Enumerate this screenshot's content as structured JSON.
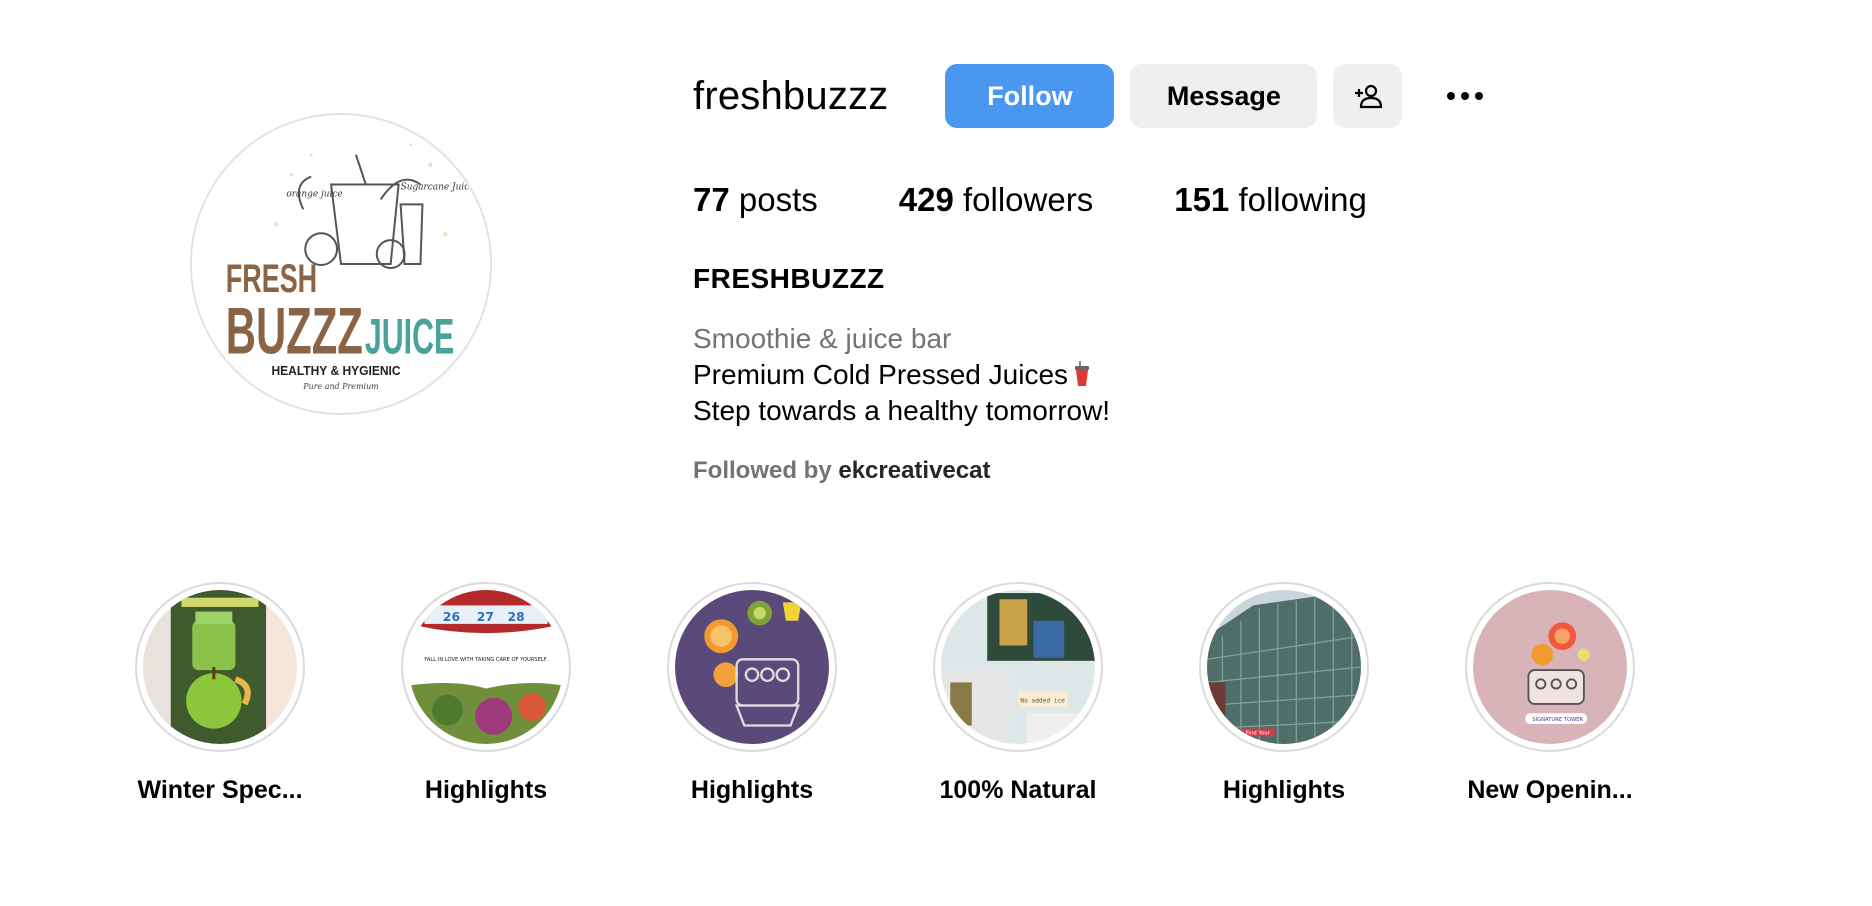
{
  "profile": {
    "username": "freshbuzzz",
    "follow_label": "Follow",
    "message_label": "Message",
    "add_user_icon": "person-add-icon",
    "more_icon": "more-options-icon",
    "stats": {
      "posts_count": "77",
      "posts_label": "posts",
      "followers_count": "429",
      "followers_label": "followers",
      "following_count": "151",
      "following_label": "following"
    },
    "full_name": "FRESHBUZZZ",
    "category": "Smoothie & juice bar",
    "bio_line_1": "Premium Cold Pressed Juices",
    "bio_line_2": "Step towards a healthy tomorrow!",
    "followed_by_prefix": "Followed by",
    "followed_by_user": "ekcreativecat",
    "logo": {
      "line1": "FRESH",
      "line2": "BUZZZ",
      "line3": "JUICE",
      "tagline": "HEALTHY & HYGIENIC",
      "subtag": "Pure and Premium",
      "note_left": "orange juice",
      "note_right": "Sugarcane Juice"
    }
  },
  "highlights": [
    {
      "label": "Winter Spec..."
    },
    {
      "label": "Highlights",
      "image_text": "FALL IN LOVE WITH TAKING CARE OF YOURSELF."
    },
    {
      "label": "Highlights"
    },
    {
      "label": "100% Natural",
      "image_text": "No added ice"
    },
    {
      "label": "Highlights",
      "image_text": "Find Your"
    },
    {
      "label": "New Openin...",
      "image_text": "SIGNATURE TOWER"
    }
  ],
  "colors": {
    "follow_button": "#4a97f1",
    "secondary_button": "#efefef",
    "muted_text": "#737373",
    "logo_brown": "#8a6444",
    "logo_teal": "#4aa39b"
  }
}
